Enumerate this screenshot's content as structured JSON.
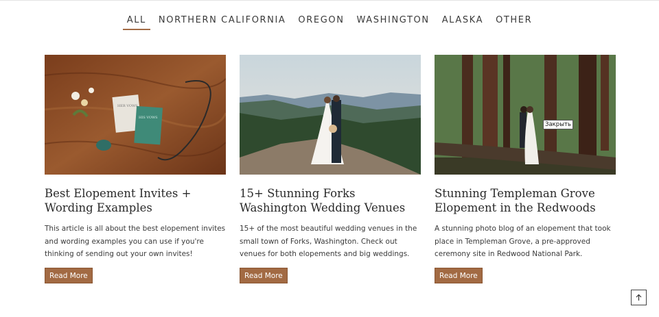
{
  "filters": {
    "items": [
      "ALL",
      "NORTHERN CALIFORNIA",
      "OREGON",
      "WASHINGTON",
      "ALASKA",
      "OTHER"
    ],
    "active": "ALL"
  },
  "posts": [
    {
      "title": "Best Elopement Invites + Wording Examples",
      "excerpt": "This article is all about the best elopement invites and wording examples you can use if you're thinking of sending out your own invites!",
      "button": "Read More",
      "image_text": [
        "HER VOWS",
        "HIS VOWS"
      ]
    },
    {
      "title": "15+ Stunning Forks Washington Wedding Venues",
      "excerpt": "15+ of the most beautiful wedding venues in the small town of Forks, Washington. Check out venues for both elopements and big weddings.",
      "button": "Read More"
    },
    {
      "title": "Stunning Templeman Grove Elopement in the Redwoods",
      "excerpt": "A stunning photo blog of an elopement that took place in Templeman Grove, a pre-approved ceremony site in Redwood National Park.",
      "button": "Read More"
    }
  ],
  "tooltip": "Закрыть",
  "back_to_top_icon": "arrow-up-icon",
  "colors": {
    "accent": "#a26a43"
  }
}
